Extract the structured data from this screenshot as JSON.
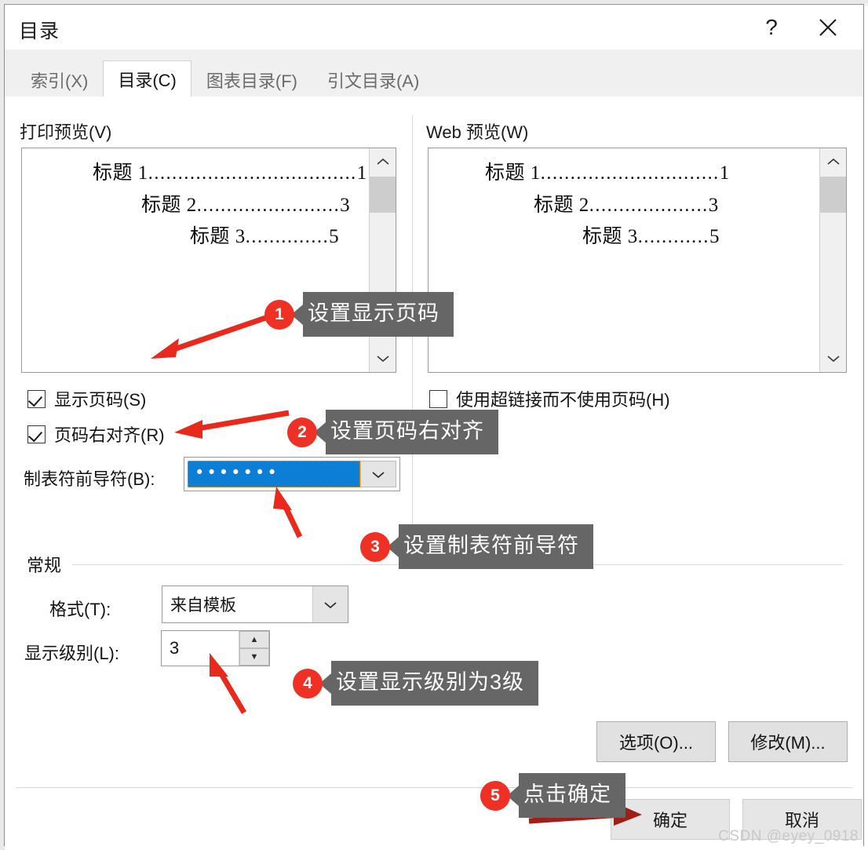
{
  "window": {
    "title": "目录",
    "help_icon": "question-mark-icon",
    "close_icon": "close-icon",
    "help_label": "?"
  },
  "tabs": [
    {
      "label": "索引(X)",
      "active": false
    },
    {
      "label": "目录(C)",
      "active": true
    },
    {
      "label": "图表目录(F)",
      "active": false
    },
    {
      "label": "引文目录(A)",
      "active": false
    }
  ],
  "print_preview": {
    "label": "打印预览(V)",
    "entries": [
      {
        "text": "标题 1",
        "dots": "...................................",
        "page": "1",
        "indent": 0
      },
      {
        "text": "标题 2",
        "dots": "........................",
        "page": "3",
        "indent": 1
      },
      {
        "text": "标题 3",
        "dots": "..............",
        "page": "5",
        "indent": 2
      }
    ]
  },
  "web_preview": {
    "label": "Web 预览(W)",
    "entries": [
      {
        "text": "标题 1",
        "dots": "..............................",
        "page": "1",
        "indent": 0
      },
      {
        "text": "标题 2",
        "dots": "....................",
        "page": "3",
        "indent": 1
      },
      {
        "text": "标题 3",
        "dots": "............",
        "page": "5",
        "indent": 2
      }
    ]
  },
  "options": {
    "show_page_numbers": {
      "label": "显示页码(S)",
      "checked": true
    },
    "right_align_page_numbers": {
      "label": "页码右对齐(R)",
      "checked": true
    },
    "use_hyperlinks": {
      "label": "使用超链接而不使用页码(H)",
      "checked": false
    },
    "tab_leader": {
      "label": "制表符前导符(B):",
      "value_dots": "•••••••",
      "selected_option": "........",
      "arrow_icon": "chevron-down-icon"
    }
  },
  "general": {
    "section_label": "常规",
    "format": {
      "label": "格式(T):",
      "value": "来自模板",
      "arrow_icon": "chevron-down-icon"
    },
    "levels": {
      "label": "显示级别(L):",
      "value": "3",
      "up_icon": "spinner-up-icon",
      "down_icon": "spinner-down-icon"
    }
  },
  "buttons": {
    "options": "选项(O)...",
    "modify": "修改(M)...",
    "ok": "确定",
    "cancel": "取消"
  },
  "annotations": [
    {
      "num": "1",
      "text": "设置显示页码"
    },
    {
      "num": "2",
      "text": "设置页码右对齐"
    },
    {
      "num": "3",
      "text": "设置制表符前导符"
    },
    {
      "num": "4",
      "text": "设置显示级别为3级"
    },
    {
      "num": "5",
      "text": "点击确定"
    }
  ],
  "watermark": "CSDN @eyey_0918",
  "colors": {
    "accent_red": "#ee3124",
    "callout_gray": "#666666",
    "selection_blue": "#0c7ed6",
    "arrow_red": "#e8291c"
  }
}
